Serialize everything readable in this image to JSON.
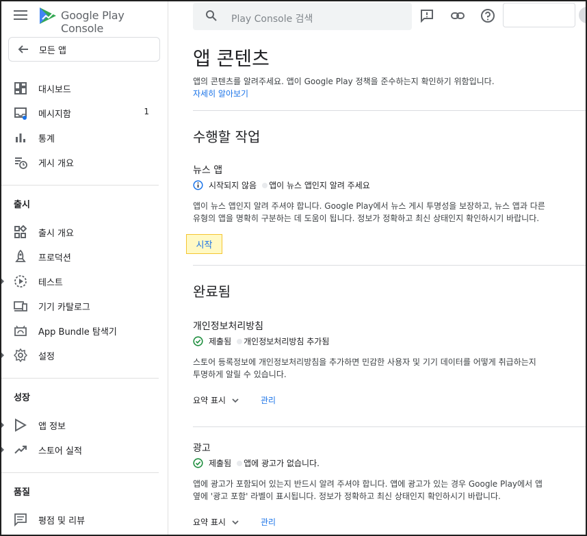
{
  "header": {
    "brand_google": "Google Play",
    "brand_console": "Console",
    "search_placeholder": "Play Console 검색"
  },
  "sidebar": {
    "back_label": "모든 앱",
    "items_top": [
      {
        "label": "대시보드",
        "icon": "dashboard-icon"
      },
      {
        "label": "메시지함",
        "icon": "inbox-icon",
        "count": "1"
      },
      {
        "label": "통계",
        "icon": "stats-icon"
      },
      {
        "label": "게시 개요",
        "icon": "publishing-overview-icon"
      }
    ],
    "section_release": "출시",
    "items_release": [
      {
        "label": "출시 개요",
        "icon": "release-overview-icon"
      },
      {
        "label": "프로덕션",
        "icon": "production-icon"
      },
      {
        "label": "테스트",
        "icon": "testing-icon"
      },
      {
        "label": "기기 카탈로그",
        "icon": "device-catalog-icon"
      },
      {
        "label": "App Bundle 탐색기",
        "icon": "app-bundle-icon"
      },
      {
        "label": "설정",
        "icon": "settings-icon"
      }
    ],
    "section_grow": "성장",
    "items_grow": [
      {
        "label": "앱 정보",
        "icon": "store-presence-icon"
      },
      {
        "label": "스토어 실적",
        "icon": "store-performance-icon"
      }
    ],
    "section_quality": "품질",
    "items_quality": [
      {
        "label": "평점 및 리뷰",
        "icon": "ratings-reviews-icon"
      }
    ]
  },
  "main": {
    "title": "앱 콘텐츠",
    "intro": "앱의 콘텐츠를 알려주세요. 앱이 Google Play 정책을 준수하는지 확인하기 위함입니다.",
    "learn_more": "자세히 알아보기",
    "todo_heading": "수행할 작업",
    "news": {
      "title": "뉴스 앱",
      "status": "시작되지 않음",
      "status_detail": "앱이 뉴스 앱인지 알려 주세요",
      "line1": "앱이 뉴스 앱인지 알려 주셔야 합니다. Google Play에서 뉴스 게시 투명성을 보장하고, 뉴스 앱과 다른",
      "line2": "유형의 앱을 명확히 구분하는 데 도움이 됩니다. 정보가 정확하고 최신 상태인지 확인하시기 바랍니다.",
      "start": "시작"
    },
    "done_heading": "완료됨",
    "privacy": {
      "title": "개인정보처리방침",
      "status": "제출됨",
      "status_detail": "개인정보처리방침 추가됨",
      "line1": "스토어 등록정보에 개인정보처리방침을 추가하면 민감한 사용자 및 기기 데이터를 어떻게 취급하는지",
      "line2": "투명하게 알릴 수 있습니다.",
      "summary": "요약 표시",
      "manage": "관리"
    },
    "ads": {
      "title": "광고",
      "status": "제출됨",
      "status_detail": "앱에 광고가 없습니다.",
      "line1": "앱에 광고가 포함되어 있는지 반드시 알려 주셔야 합니다. 앱에 광고가 있는 경우 Google Play에서 앱",
      "line2": "옆에 '광고 포함' 라벨이 표시됩니다. 정보가 정확하고 최신 상태인지 확인하시기 바랍니다.",
      "summary": "요약 표시",
      "manage": "관리"
    }
  },
  "colors": {
    "accent": "#1a73e8",
    "success": "#1e8e3e",
    "highlight": "#fff9c4"
  }
}
